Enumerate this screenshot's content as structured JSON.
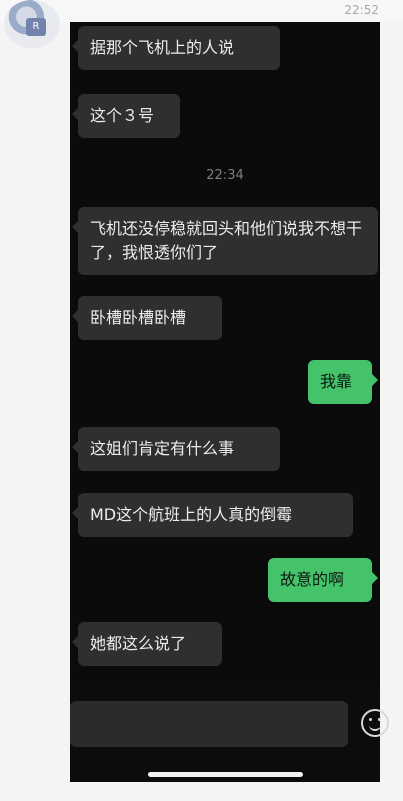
{
  "status": {
    "time_top": "22:52"
  },
  "chat": {
    "center_time": "22:34",
    "messages": [
      {
        "side": "left",
        "text": "据那个飞机上的人说"
      },
      {
        "side": "left",
        "text": "这个３号"
      },
      {
        "side": "left",
        "text": "飞机还没停稳就回头和他们说我不想干了，我恨透你们了"
      },
      {
        "side": "left",
        "text": "卧槽卧槽卧槽"
      },
      {
        "side": "right",
        "text": "我靠"
      },
      {
        "side": "left",
        "text": "这姐们肯定有什么事"
      },
      {
        "side": "left",
        "text": "MD这个航班上的人真的倒霉"
      },
      {
        "side": "right",
        "text": "故意的啊"
      },
      {
        "side": "left",
        "text": "她都这么说了"
      }
    ]
  },
  "avatar": {
    "badge_text": "R"
  }
}
